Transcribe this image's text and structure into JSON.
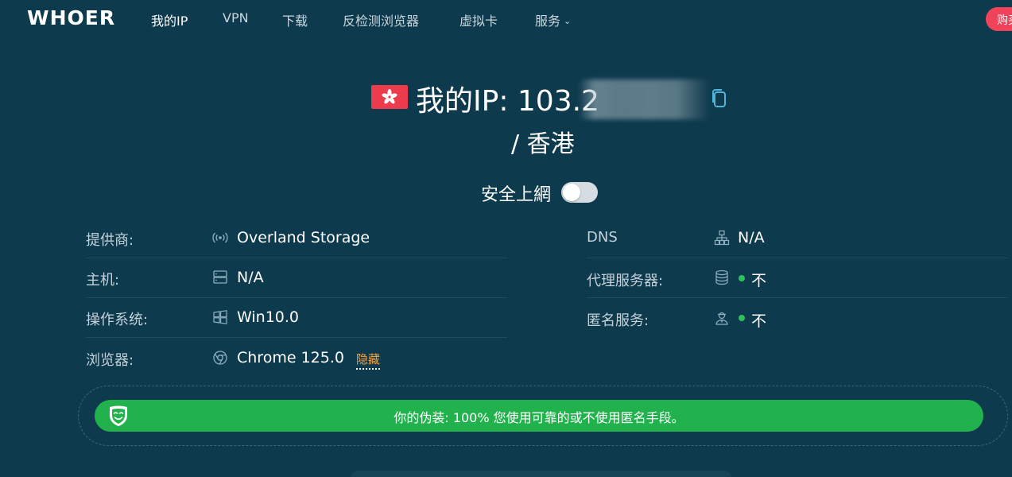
{
  "nav": {
    "logo": "WHOER",
    "items": [
      {
        "label": "我的IP",
        "active": true
      },
      {
        "label": "VPN",
        "active": false
      },
      {
        "label": "下载",
        "active": false
      },
      {
        "label": "反检测浏览器",
        "active": false
      },
      {
        "label": "虚拟卡",
        "active": false
      },
      {
        "label": "服务",
        "active": false,
        "dropdown": true
      }
    ],
    "buy_label": "购买"
  },
  "hero": {
    "flag_icon": "hong-kong-flag-icon",
    "ip_label": "我的IP: 103.2",
    "location": "/ 香港",
    "safe_label": "安全上網",
    "safe_toggle_on": false
  },
  "info": {
    "left": [
      {
        "label": "提供商:",
        "icon": "antenna-icon",
        "value": "Overland Storage"
      },
      {
        "label": "主机:",
        "icon": "server-icon",
        "value": "N/A"
      },
      {
        "label": "操作系统:",
        "icon": "windows-icon",
        "value": "Win10.0"
      },
      {
        "label": "浏览器:",
        "icon": "chrome-icon",
        "value": "Chrome 125.0",
        "link": "隐藏"
      }
    ],
    "right": [
      {
        "label": "DNS",
        "icon": "network-icon",
        "value": "N/A"
      },
      {
        "label": "代理服务器:",
        "icon": "database-icon",
        "value": "不",
        "status_color": "#2ec05c"
      },
      {
        "label": "匿名服务:",
        "icon": "user-incognito-icon",
        "value": "不",
        "status_color": "#2ec05c"
      }
    ]
  },
  "status": {
    "icon": "mask-icon",
    "text": "你的伪装: 100% 您使用可靠的或不使用匿名手段。"
  },
  "colors": {
    "background": "#0e3a4d",
    "accent_red": "#f0435a",
    "status_green": "#22b24d",
    "link_orange": "#f0a043"
  }
}
